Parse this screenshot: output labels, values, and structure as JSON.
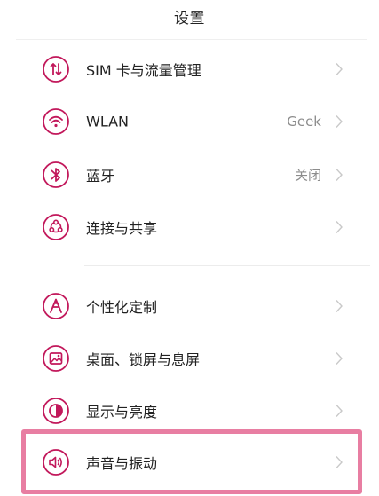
{
  "header": {
    "title": "设置"
  },
  "accent_color": "#c2185b",
  "highlight_color": "#e87ea2",
  "settings": [
    {
      "label": "SIM 卡与流量管理",
      "value": "",
      "icon": "sim-data-icon"
    },
    {
      "label": "WLAN",
      "value": "Geek",
      "icon": "wifi-icon"
    },
    {
      "label": "蓝牙",
      "value": "关闭",
      "icon": "bluetooth-icon"
    },
    {
      "label": "连接与共享",
      "value": "",
      "icon": "connection-sharing-icon"
    },
    {
      "label": "个性化定制",
      "value": "",
      "icon": "personalization-icon"
    },
    {
      "label": "桌面、锁屏与息屏",
      "value": "",
      "icon": "wallpaper-icon"
    },
    {
      "label": "显示与亮度",
      "value": "",
      "icon": "display-brightness-icon"
    },
    {
      "label": "声音与振动",
      "value": "",
      "icon": "sound-vibration-icon"
    }
  ]
}
